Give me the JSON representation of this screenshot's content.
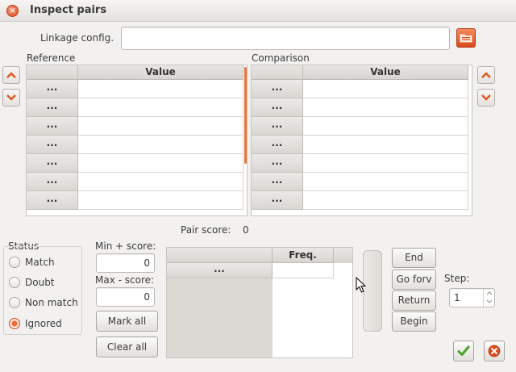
{
  "window": {
    "title": "Inspect pairs"
  },
  "linkage": {
    "label": "Linkage config.",
    "value": ""
  },
  "reference": {
    "label": "Reference",
    "columns": [
      "",
      "Value"
    ],
    "rows": [
      "...",
      "...",
      "...",
      "...",
      "...",
      "...",
      "..."
    ]
  },
  "comparison": {
    "label": "Comparison",
    "columns": [
      "",
      "Value"
    ],
    "rows": [
      "...",
      "...",
      "...",
      "...",
      "...",
      "...",
      "..."
    ]
  },
  "pair_score": {
    "label": "Pair score:",
    "value": "0"
  },
  "status": {
    "label": "Status",
    "options": [
      "Match",
      "Doubt",
      "Non match",
      "Ignored"
    ],
    "selected": "Ignored"
  },
  "scores": {
    "min_label": "Min + score:",
    "min_value": "0",
    "max_label": "Max - score:",
    "max_value": "0"
  },
  "buttons": {
    "mark_all": "Mark all",
    "clear_all": "Clear all",
    "end": "End",
    "go_forward": "Go forv",
    "return": "Return",
    "begin": "Begin"
  },
  "freq_table": {
    "columns": [
      "",
      "Freq."
    ],
    "rows": [
      "..."
    ]
  },
  "step": {
    "label": "Step:",
    "value": "1"
  },
  "colors": {
    "accent": "#e8763f",
    "ok_green": "#4aa125",
    "cancel_red": "#df4a1d"
  },
  "icons": {
    "close": "close-icon",
    "folder": "folder-open-icon",
    "up": "chevron-up-icon",
    "down": "chevron-down-icon",
    "ok": "checkmark-icon",
    "cancel": "cancel-icon"
  }
}
